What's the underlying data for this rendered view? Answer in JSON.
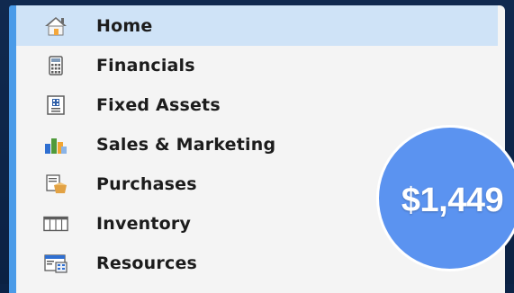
{
  "menu": {
    "items": [
      {
        "label": "Home",
        "icon": "home-icon",
        "active": true
      },
      {
        "label": "Financials",
        "icon": "calculator-icon",
        "active": false
      },
      {
        "label": "Fixed Assets",
        "icon": "building-document-icon",
        "active": false
      },
      {
        "label": "Sales & Marketing",
        "icon": "bar-chart-icon",
        "active": false
      },
      {
        "label": "Purchases",
        "icon": "purchase-box-icon",
        "active": false
      },
      {
        "label": "Inventory",
        "icon": "table-grid-icon",
        "active": false
      },
      {
        "label": "Resources",
        "icon": "resources-calendar-icon",
        "active": false
      }
    ]
  },
  "price_badge": {
    "text": "$1,449"
  },
  "colors": {
    "background": "#0c2347",
    "panel": "#f4f4f4",
    "accent": "#4a9be8",
    "active_row": "#cfe3f7",
    "badge": "#5b93f0"
  }
}
